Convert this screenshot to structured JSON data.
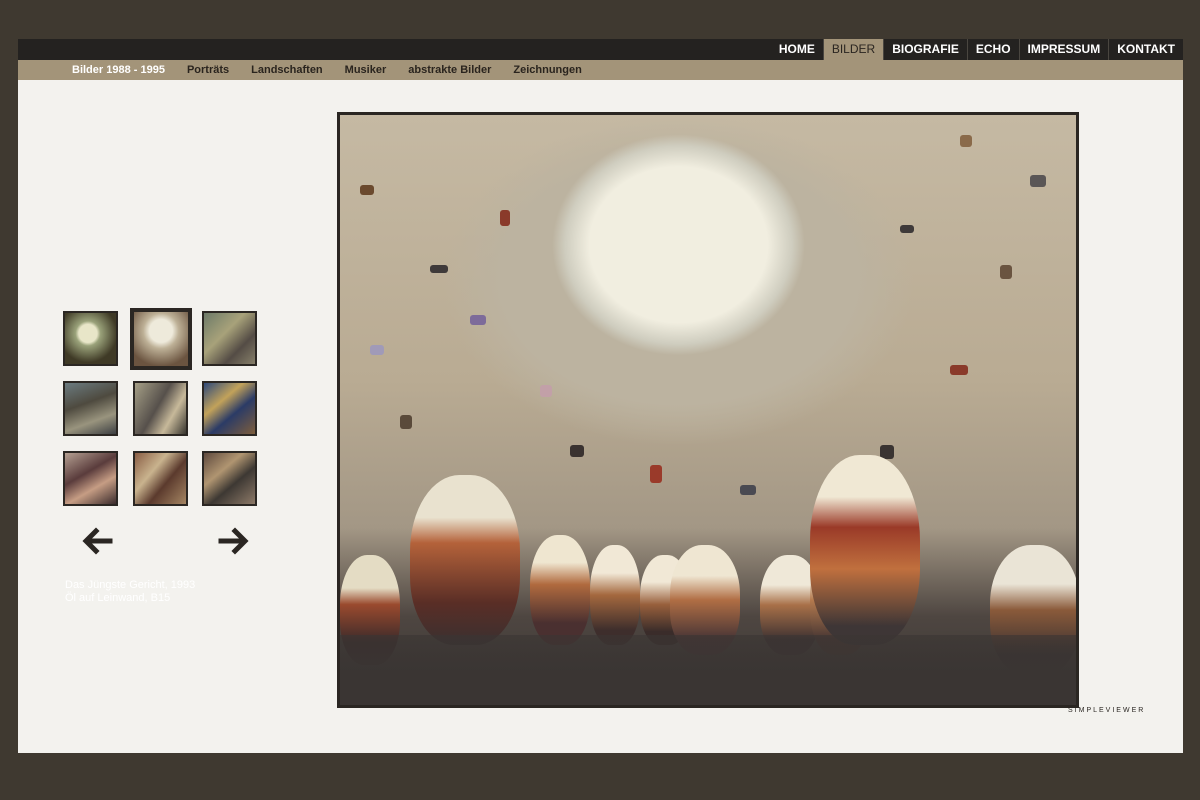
{
  "main_nav": {
    "items": [
      {
        "label": "HOME",
        "active": false
      },
      {
        "label": "BILDER",
        "active": true
      },
      {
        "label": "BIOGRAFIE",
        "active": false
      },
      {
        "label": "ECHO",
        "active": false
      },
      {
        "label": "IMPRESSUM",
        "active": false
      },
      {
        "label": "KONTAKT",
        "active": false
      }
    ]
  },
  "sub_nav": {
    "items": [
      {
        "label": "Bilder 1988 - 1995",
        "active": true
      },
      {
        "label": "Porträts",
        "active": false
      },
      {
        "label": "Landschaften",
        "active": false
      },
      {
        "label": "Musiker",
        "active": false
      },
      {
        "label": "abstrakte Bilder",
        "active": false
      },
      {
        "label": "Zeichnungen",
        "active": false
      }
    ]
  },
  "gallery": {
    "thumbnail_count": 9,
    "selected_thumbnail": 2,
    "prev_icon": "arrow-left-icon",
    "next_icon": "arrow-right-icon",
    "caption": {
      "line1": "Das Jüngste Gericht, 1993",
      "line2": "Öl auf Leinwand, B15"
    },
    "viewer_label": "SIMPLEVIEWER"
  },
  "colors": {
    "outer_background": "#3f3930",
    "top_bar": "#242220",
    "sub_bar": "#a39479",
    "content_background": "#f3f2ee"
  }
}
